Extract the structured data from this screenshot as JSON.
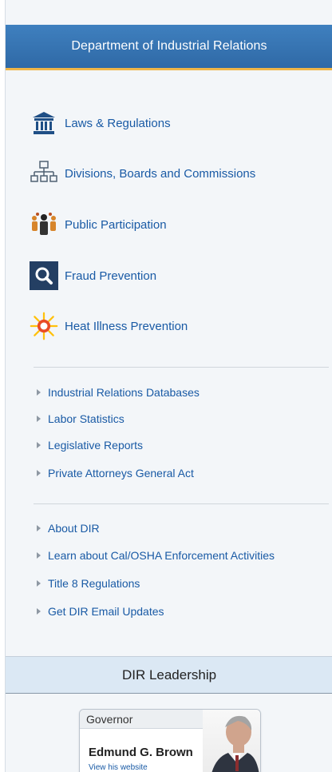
{
  "header": {
    "title": "Department of Industrial Relations"
  },
  "features": [
    {
      "icon": "courthouse-icon",
      "label": "Laws & Regulations"
    },
    {
      "icon": "org-chart-icon",
      "label": "Divisions, Boards and Commissions"
    },
    {
      "icon": "people-icon",
      "label": "Public Participation"
    },
    {
      "icon": "magnifier-icon",
      "label": "Fraud Prevention"
    },
    {
      "icon": "sun-icon",
      "label": "Heat Illness Prevention"
    }
  ],
  "links_group_1": [
    "Industrial Relations Databases",
    "Labor Statistics",
    "Legislative Reports",
    "Private Attorneys General Act"
  ],
  "links_group_2": [
    "About DIR",
    "Learn about Cal/OSHA Enforcement Activities",
    "Title 8 Regulations",
    "Get DIR Email Updates"
  ],
  "leadership": {
    "title": "DIR Leadership",
    "governor": {
      "role": "Governor",
      "name": "Edmund G. Brown",
      "link": "View his website"
    }
  },
  "colors": {
    "header_blue": "#2f69a6",
    "header_accent": "#efb548",
    "link_blue": "#195aa5"
  }
}
